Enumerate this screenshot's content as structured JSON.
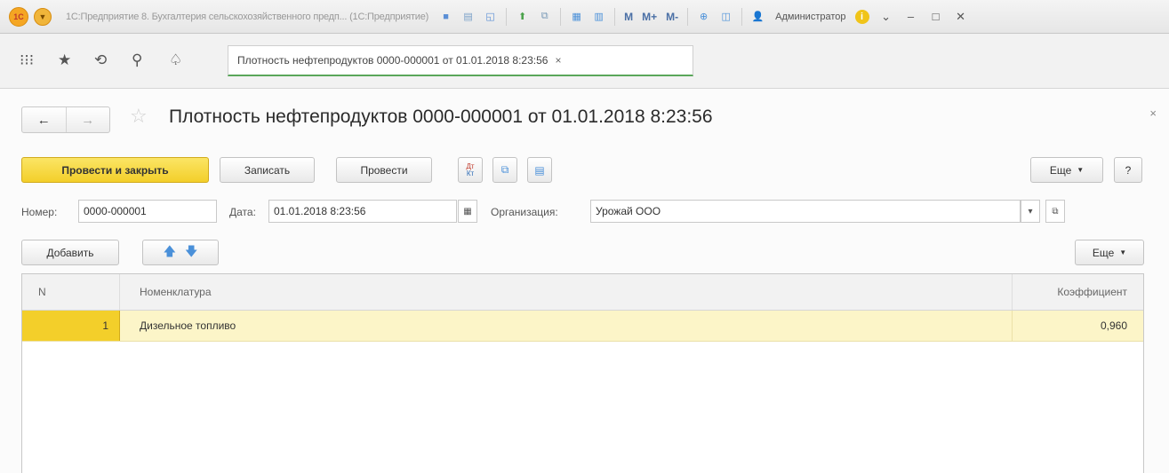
{
  "window": {
    "title": "1С:Предприятие 8. Бухгалтерия сельскохозяйственного предп... (1С:Предприятие)",
    "logo_text": "1С",
    "m_label": "M",
    "mplus_label": "M+",
    "mminus_label": "M-",
    "user": "Администратор",
    "info_label": "i"
  },
  "tab": {
    "label": "Плотность нефтепродуктов 0000-000001 от 01.01.2018 8:23:56",
    "close": "×"
  },
  "document": {
    "title": "Плотность нефтепродуктов 0000-000001 от 01.01.2018 8:23:56",
    "close": "×"
  },
  "toolbar": {
    "post_close": "Провести и закрыть",
    "save": "Записать",
    "post": "Провести",
    "dtkt_top": "Дт",
    "dtkt_bottom": "Кт",
    "more": "Еще",
    "help": "?"
  },
  "fields": {
    "number_label": "Номер:",
    "number_value": "0000-000001",
    "date_label": "Дата:",
    "date_value": "01.01.2018  8:23:56",
    "org_label": "Организация:",
    "org_value": "Урожай ООО"
  },
  "table_toolbar": {
    "add": "Добавить",
    "more": "Еще"
  },
  "table": {
    "columns": [
      "N",
      "Номенклатура",
      "Коэффициент"
    ],
    "rows": [
      {
        "n": "1",
        "item": "Дизельное топливо",
        "coef": "0,960"
      }
    ]
  }
}
